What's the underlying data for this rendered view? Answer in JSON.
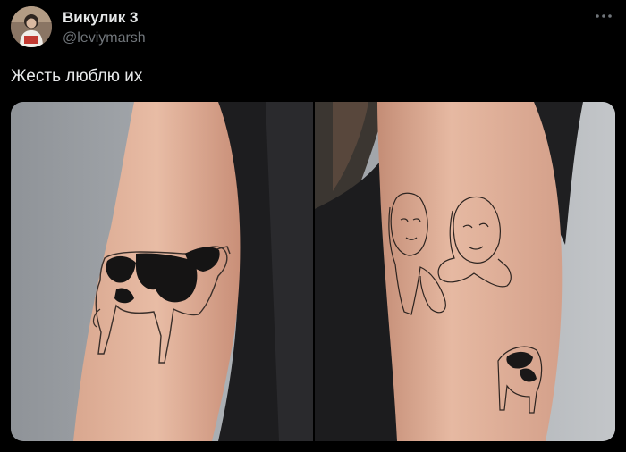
{
  "author": {
    "display_name": "Викулик 3",
    "handle": "@leviymarsh"
  },
  "tweet": {
    "text": "Жесть люблю их"
  },
  "icons": {
    "more": "more-horizontal-icon"
  },
  "colors": {
    "background": "#000000",
    "primary_text": "#e7e9ea",
    "secondary_text": "#71767b"
  }
}
